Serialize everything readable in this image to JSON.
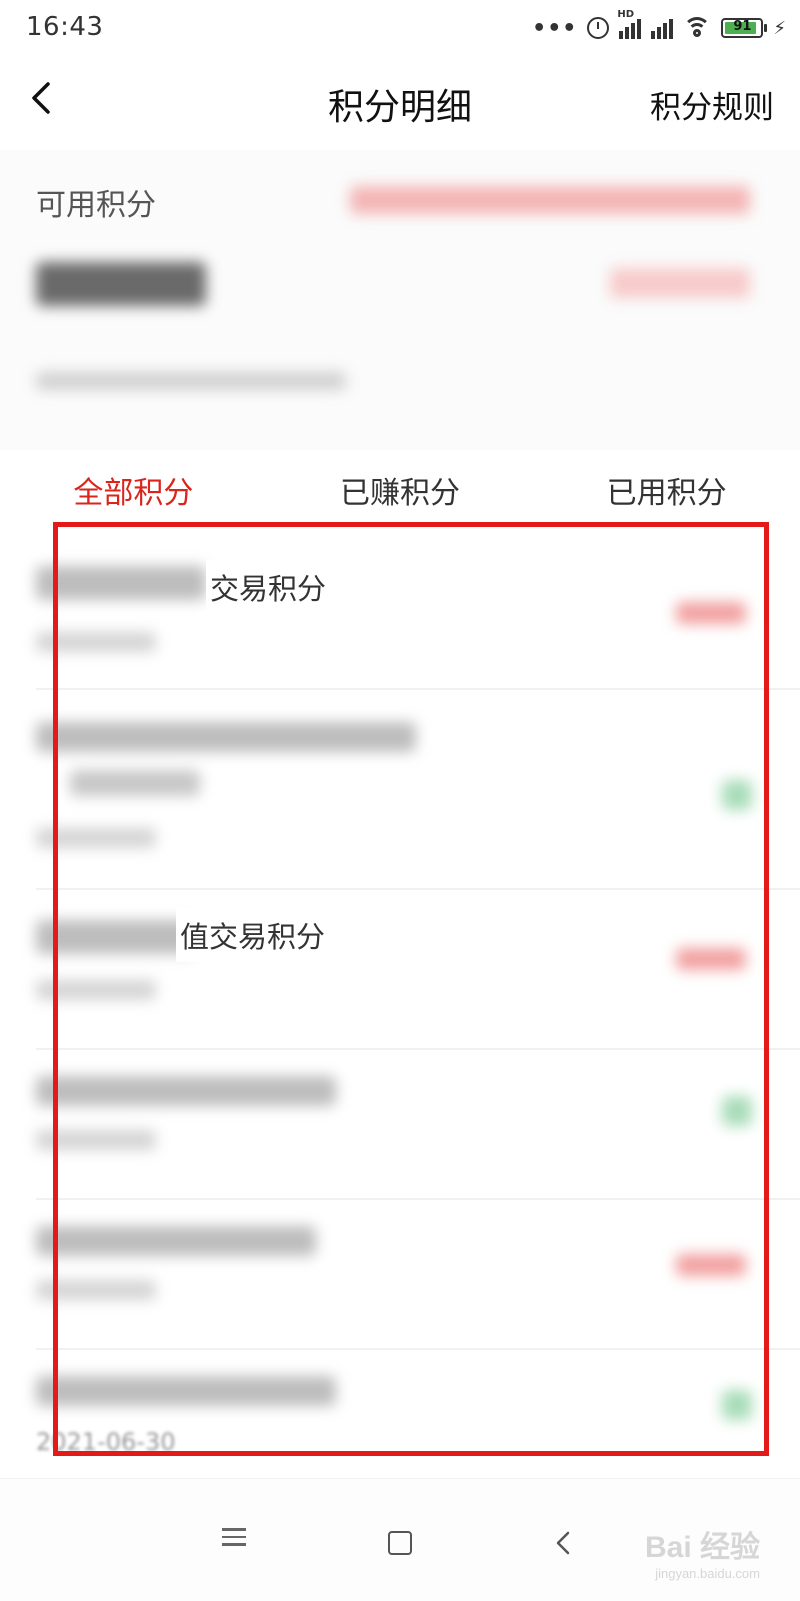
{
  "status_bar": {
    "time": "16:43",
    "dots": "•••",
    "hd_label": "HD",
    "battery_level": "91",
    "charging_icon": "⚡"
  },
  "header": {
    "back_icon": "chevron-left-icon",
    "title": "积分明细",
    "rules_link": "积分规则"
  },
  "summary": {
    "available_points_label": "可用积分"
  },
  "tabs": [
    {
      "label": "全部积分",
      "active": true
    },
    {
      "label": "已赚积分",
      "active": false
    },
    {
      "label": "已用积分",
      "active": false
    }
  ],
  "records": [
    {
      "title_visible": "交易积分"
    },
    {
      "title_visible": ""
    },
    {
      "title_visible": "值交易积分"
    },
    {
      "title_visible": ""
    },
    {
      "title_visible": ""
    },
    {
      "title_visible": "",
      "date": "2021-06-30"
    }
  ],
  "navigation": {
    "menu_icon": "menu-icon",
    "home_icon": "home-icon",
    "back_icon": "back-triangle-icon"
  },
  "watermark": {
    "main": "Bai 经验",
    "sub": "jingyan.baidu.com"
  },
  "colors": {
    "accent_red": "#d9251c",
    "highlight_border": "#e31a1a",
    "earn_red": "#f2a0a0",
    "spend_green": "#a8dcb8"
  }
}
